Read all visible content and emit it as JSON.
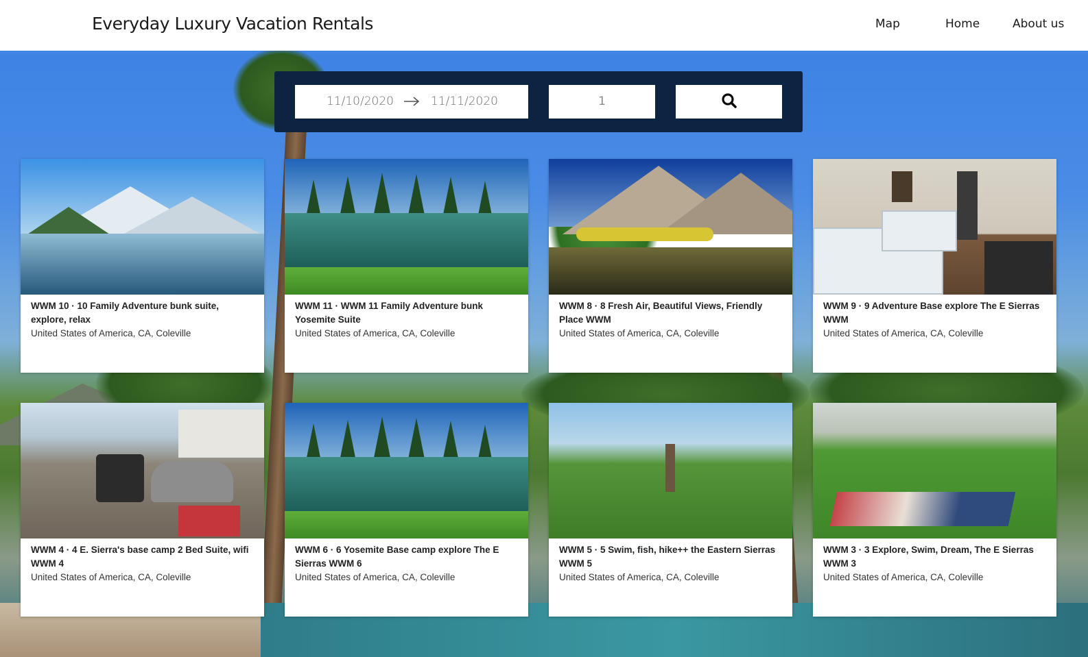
{
  "header": {
    "brand": "Everyday Luxury Vacation Rentals",
    "nav": {
      "map": "Map",
      "home": "Home",
      "about": "About us"
    }
  },
  "search": {
    "start_date": "11/10/2020",
    "end_date": "11/11/2020",
    "guests": "1"
  },
  "listings": [
    {
      "title": "WWM 10 · 10 Family Adventure bunk suite, explore, relax",
      "location": "United States of America, CA, Coleville"
    },
    {
      "title": "WWM 11 · WWM 11 Family Adventure bunk Yosemite Suite",
      "location": "United States of America, CA, Coleville"
    },
    {
      "title": "WWM 8 · 8 Fresh Air, Beautiful Views, Friendly Place WWM",
      "location": "United States of America, CA, Coleville"
    },
    {
      "title": "WWM 9 · 9 Adventure Base explore The E Sierras WWM",
      "location": "United States of America, CA, Coleville"
    },
    {
      "title": "WWM 4 · 4 E. Sierra's base camp 2 Bed Suite, wifi WWM 4",
      "location": "United States of America, CA, Coleville"
    },
    {
      "title": "WWM 6 · 6 Yosemite Base camp explore The E Sierras WWM 6",
      "location": "United States of America, CA, Coleville"
    },
    {
      "title": "WWM 5 · 5 Swim, fish, hike++ the Eastern Sierras WWM 5",
      "location": "United States of America, CA, Coleville"
    },
    {
      "title": "WWM 3 · 3 Explore, Swim, Dream, The E Sierras WWM 3",
      "location": "United States of America, CA, Coleville"
    }
  ],
  "colors": {
    "header_bg": "#ffffff",
    "search_panel": "#0c2341",
    "sky": "#3b7fe0"
  },
  "icons": {
    "arrow": "arrow-right-icon",
    "search": "search-icon"
  }
}
